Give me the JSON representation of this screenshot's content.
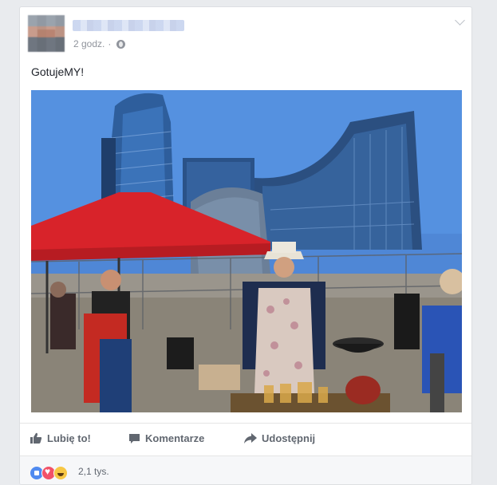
{
  "post": {
    "time": "2 godz.",
    "separator": "·",
    "text": "GotujeMY!"
  },
  "actions": {
    "like_label": "Lubię to!",
    "comment_label": "Komentarze",
    "share_label": "Udostępnij"
  },
  "reactions": {
    "icons": [
      "like-reaction-icon",
      "love-reaction-icon",
      "haha-reaction-icon"
    ],
    "count": "2,1 tys."
  },
  "colors": {
    "page_bg": "#e9ebee",
    "action_text": "#616770",
    "tent_red": "#e0262b",
    "sky": "#4f87d6"
  }
}
